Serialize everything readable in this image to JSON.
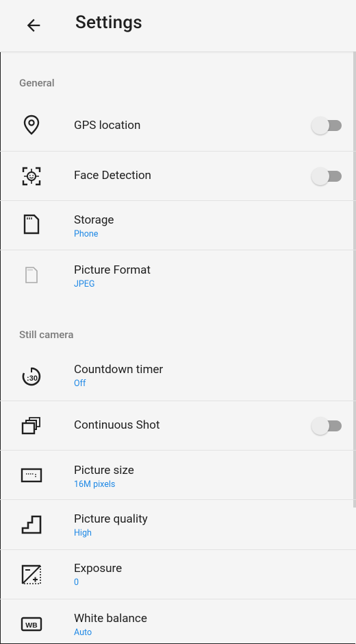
{
  "header": {
    "title": "Settings"
  },
  "sections": {
    "general": "General",
    "still_camera": "Still camera"
  },
  "items": {
    "gps": {
      "label": "GPS location",
      "enabled": false
    },
    "face": {
      "label": "Face Detection",
      "enabled": false
    },
    "storage": {
      "label": "Storage",
      "value": "Phone"
    },
    "format": {
      "label": "Picture Format",
      "value": "JPEG"
    },
    "countdown": {
      "label": "Countdown timer",
      "value": "Off",
      "icon_text": ":30"
    },
    "continuous": {
      "label": "Continuous Shot",
      "enabled": false
    },
    "size": {
      "label": "Picture size",
      "value": "16M pixels"
    },
    "quality": {
      "label": "Picture quality",
      "value": "High"
    },
    "exposure": {
      "label": "Exposure",
      "value": "0"
    },
    "wb": {
      "label": "White balance",
      "value": "Auto",
      "icon_text": "WB"
    }
  },
  "colors": {
    "accent": "#1e88e5",
    "background": "#f5f5f5",
    "toggle_off": "#9e9e9e"
  }
}
